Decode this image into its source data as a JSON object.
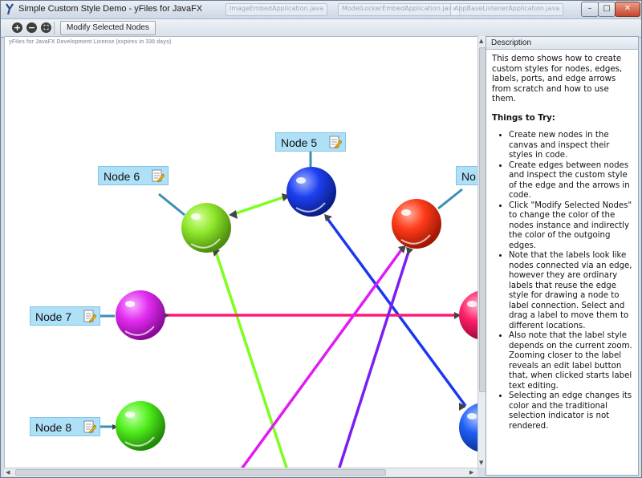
{
  "window": {
    "title": "Simple Custom Style Demo - yFiles for JavaFX",
    "background_tabs": [
      "ImageEmbedApplication.java",
      "ModelLockerEmbedApplication.java",
      "AppBaseListenerApplication.java"
    ],
    "controls": {
      "minimize": "–",
      "maximize": "□",
      "close": "✕"
    }
  },
  "toolbar": {
    "zoom_in_icon": "zoom-in",
    "zoom_out_icon": "zoom-out",
    "fit_icon": "fit-content",
    "modify_label": "Modify Selected Nodes"
  },
  "canvas": {
    "license": "yFiles for JavaFX Development License (expires in 330 days)",
    "labels": {
      "node5": "Node 5",
      "node6": "Node 6",
      "node7": "Node 7",
      "node8": "Node 8",
      "node_partial": "No"
    },
    "node_colors": {
      "green": "#8ee62a",
      "blue": "#1e3ff0",
      "red": "#ff3b1a",
      "magenta": "#e22cf0",
      "lime": "#52f01e",
      "pink": "#ff1f6a",
      "blue2": "#1f5ff5"
    },
    "edge_colors": {
      "lime": "#7dff1e",
      "blue": "#1b36f0",
      "pink": "#ff1a78",
      "magenta": "#e11cf2",
      "purple": "#7a1ff0"
    }
  },
  "description": {
    "header": "Description",
    "intro": "This demo shows how to create custom styles for nodes, edges, labels, ports, and edge arrows from scratch and how to use them.",
    "things_title": "Things to Try:",
    "items": [
      "Create new nodes in the canvas and inspect their styles in code.",
      "Create edges between nodes and inspect the custom style of the edge and the arrows in code.",
      "Click \"Modify Selected Nodes\" to change the color of the nodes instance and indirectly the color of the outgoing edges.",
      "Note that the labels look like nodes connected via an edge, however they are ordinary labels that reuse the edge style for drawing a node to label connection. Select and drag a label to move them to different locations.",
      "Also note that the label style depends on the current zoom. Zooming closer to the label reveals an edit label button that, when clicked starts label text editing.",
      "Selecting an edge changes its color and the traditional selection indicator is not rendered."
    ]
  }
}
